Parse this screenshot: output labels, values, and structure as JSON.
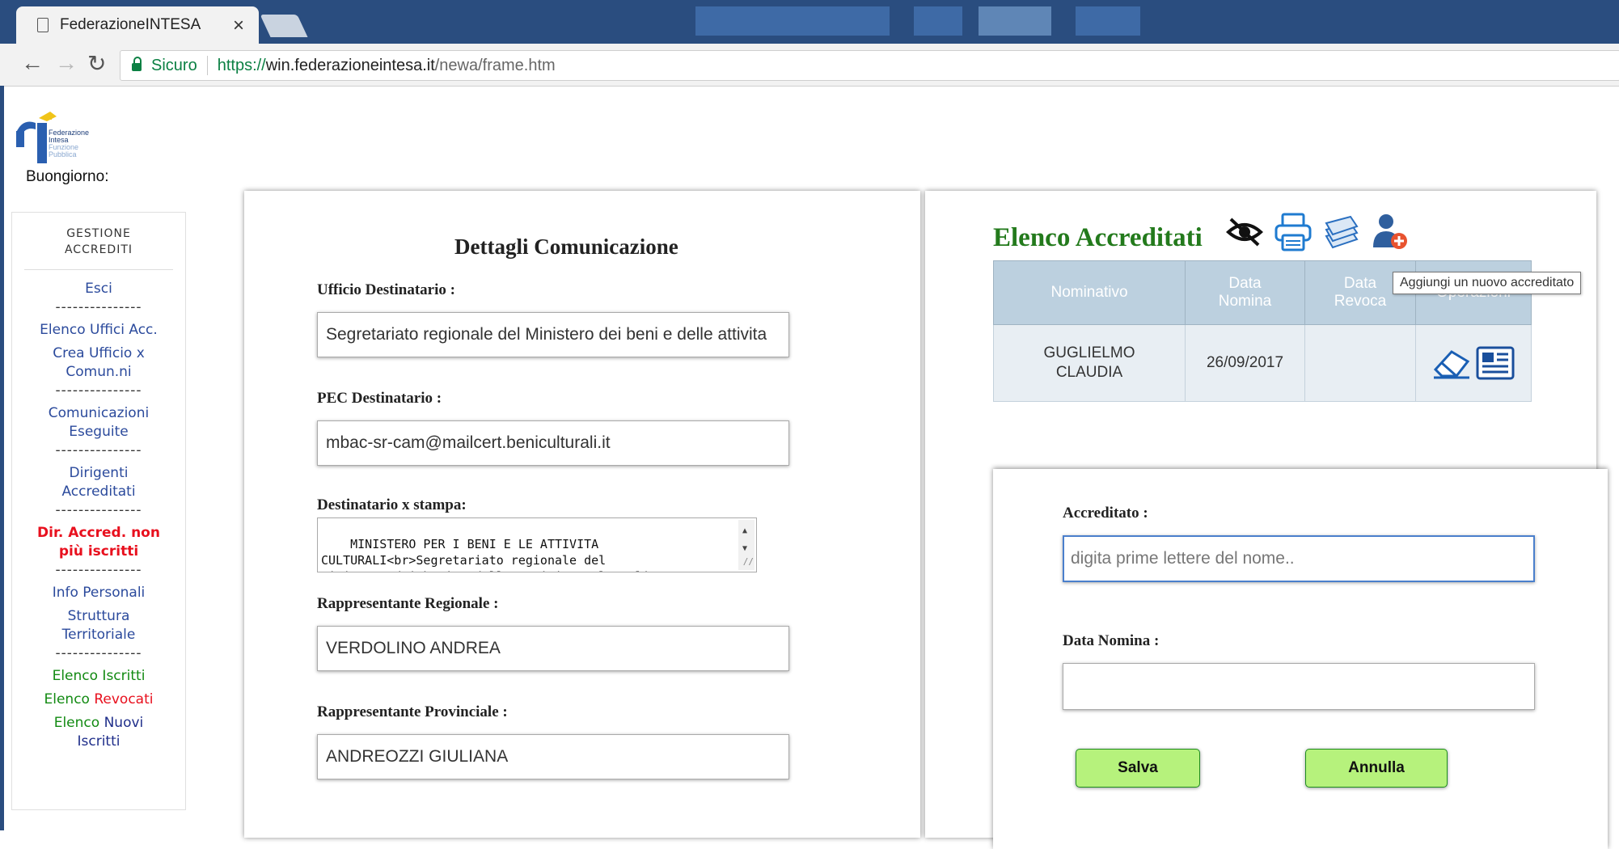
{
  "browser": {
    "tab_title": "FederazioneINTESA",
    "close_glyph": "×",
    "secure_label": "Sicuro",
    "url_protocol": "https://",
    "url_host": "win.federazioneintesa.it",
    "url_path": "/newa/frame.htm"
  },
  "logo": {
    "lines": [
      "Federazione",
      "Intesa",
      "Funzione",
      "Pubblica"
    ]
  },
  "greeting": "Buongiorno:",
  "sidebar": {
    "title_line1": "GESTIONE",
    "title_line2": "ACCREDITI",
    "separator": "---------------",
    "esci": "Esci",
    "elenco_uffici": "Elenco Uffici Acc.",
    "crea_ufficio_1": "Crea Ufficio x",
    "crea_ufficio_2": "Comun.ni",
    "comunicazioni_1": "Comunicazioni",
    "comunicazioni_2": "Eseguite",
    "dirigenti_1": "Dirigenti",
    "dirigenti_2": "Accreditati",
    "dir_non_iscritti_1": "Dir. Accred. non",
    "dir_non_iscritti_2": "più iscritti",
    "info_personali": "Info Personali",
    "struttura_1": "Struttura",
    "struttura_2": "Territoriale",
    "elenco_iscritti": "Elenco Iscritti",
    "elenco_revocati_a": "Elenco",
    "elenco_revocati_b": "Revocati",
    "elenco_nuovi_a": "Elenco",
    "elenco_nuovi_b": "Nuovi",
    "elenco_nuovi_c": "Iscritti"
  },
  "details": {
    "title": "Dettagli Comunicazione",
    "ufficio_label": "Ufficio Destinatario :",
    "ufficio_value": "Segretariato regionale del Ministero dei beni e delle attivita",
    "pec_label": "PEC Destinatario :",
    "pec_value": "mbac-sr-cam@mailcert.beniculturali.it",
    "stampa_label": "Destinatario x stampa:",
    "stampa_value": "MINISTERO PER I BENI E LE ATTIVITA\nCULTURALI<br>Segretariato regionale del\nMinistero dei beni e delle attivita culturali e",
    "regionale_label": "Rappresentante Regionale :",
    "regionale_value": "VERDOLINO ANDREA",
    "provinciale_label": "Rappresentante Provinciale :",
    "provinciale_value": "ANDREOZZI GIULIANA"
  },
  "accreditati": {
    "title": "Elenco Accreditati",
    "icons": [
      "hide-eye-icon",
      "printer-icon",
      "documents-stack-icon",
      "add-user-icon"
    ],
    "tooltip": "Aggiungi un nuovo accreditato",
    "columns": [
      "Nominativo",
      "Data Nomina",
      "Data Revoca",
      "Operazioni"
    ],
    "col_nominativo": "Nominativo",
    "col_data_nomina_1": "Data",
    "col_data_nomina_2": "Nomina",
    "col_data_revoca_1": "Data",
    "col_data_revoca_2": "Revoca",
    "col_operazioni": "Operazioni",
    "rows": [
      {
        "nome_1": "GUGLIELMO",
        "nome_2": "CLAUDIA",
        "data_nomina": "26/09/2017",
        "data_revoca": ""
      }
    ]
  },
  "form": {
    "accreditato_label": "Accreditato :",
    "accreditato_placeholder": "digita prime lettere del nome..",
    "data_nomina_label": "Data Nomina :",
    "data_nomina_value": "",
    "save_label": "Salva",
    "cancel_label": "Annulla"
  },
  "colors": {
    "accent_green": "#237a1c",
    "table_header": "#bcd0df",
    "button_green": "#b6f27c",
    "menu_red": "#e8101e",
    "menu_blue": "#2b4a9c",
    "browser_frame": "#2a4d7f"
  }
}
